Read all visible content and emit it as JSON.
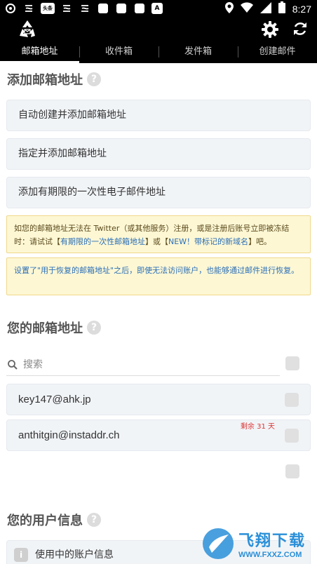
{
  "status_bar": {
    "time": "8:27",
    "notification_icons": [
      "app-icon",
      "pinyin-icon",
      "news-icon",
      "pinyin-icon",
      "pinyin-icon",
      "square-icon",
      "square-icon",
      "square-icon",
      "text-icon"
    ],
    "news_icon_text": "头条",
    "text_icon_text": "A"
  },
  "tabs": [
    {
      "label": "邮箱地址",
      "active": true
    },
    {
      "label": "收件箱",
      "active": false
    },
    {
      "label": "发件箱",
      "active": false
    },
    {
      "label": "创建邮件",
      "active": false
    }
  ],
  "add_section": {
    "title": "添加邮箱地址",
    "help": "?",
    "buttons": [
      "自动创建并添加邮箱地址",
      "指定并添加邮箱地址",
      "添加有期限的一次性电子邮件地址"
    ]
  },
  "notice_twitter": {
    "text_before": "如您的邮箱地址无法在 Twitter（或其他服务）注册，或是注册后账号立即被冻结时：请试试【",
    "link1": "有期限的一次性邮箱地址",
    "text_middle": "】或【",
    "link2": "NEW！带标记的新域名",
    "text_after": "】吧。"
  },
  "notice_recovery": {
    "text": "设置了\"用于恢复的邮箱地址\"之后，即使无法访问账户，也能够通过邮件进行恢复。"
  },
  "address_section": {
    "title": "您的邮箱地址",
    "help": "?",
    "search_placeholder": "搜索",
    "emails": [
      {
        "address": "key147@ahk.jp",
        "days_left": ""
      },
      {
        "address": "anthitgin@instaddr.ch",
        "days_left": "剩余 31 天"
      }
    ]
  },
  "user_section": {
    "title": "您的用户信息",
    "help": "?",
    "account_info": "使用中的账户信息",
    "info_icon": "i"
  },
  "watermark": {
    "name": "飞翔下载",
    "url": "WWW.FXXZ.COM"
  },
  "colors": {
    "bar_bg": "#000000",
    "tab_active": "#ffffff",
    "button_bg": "#f1f4f7",
    "notice_bg": "#fdf7d4",
    "link": "#2a6fb8",
    "days_red": "#dd3333",
    "watermark_blue": "#2a8fd8"
  }
}
